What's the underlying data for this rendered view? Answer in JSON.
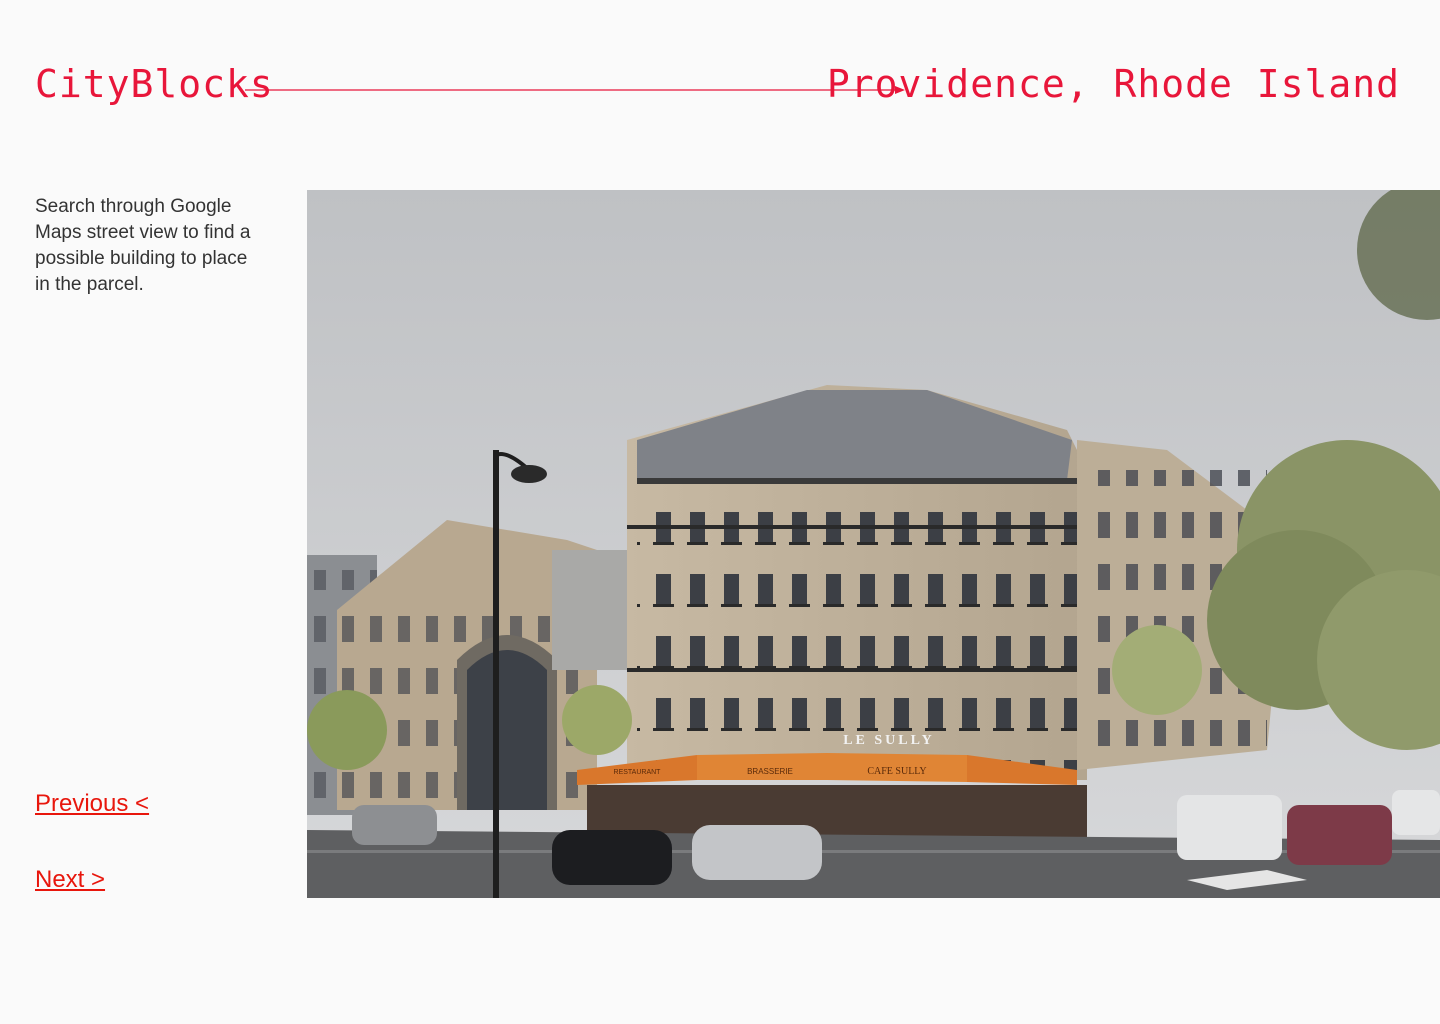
{
  "header": {
    "brand": "CityBlocks",
    "location": "Providence, Rhode Island"
  },
  "instructions": "Search through Google Maps street view to find a possible building to place in the parcel.",
  "nav": {
    "previous_label": "Previous <",
    "next_label": "Next >"
  },
  "street_view": {
    "sign_main": "LE SULLY",
    "awning_cafe": "CAFE SULLY",
    "awning_brasserie": "BRASSERIE",
    "awning_restaurant": "RESTAURANT"
  },
  "colors": {
    "accent": "#e8163a",
    "link": "#e8160c",
    "background": "#fafafa",
    "text": "#333333"
  }
}
